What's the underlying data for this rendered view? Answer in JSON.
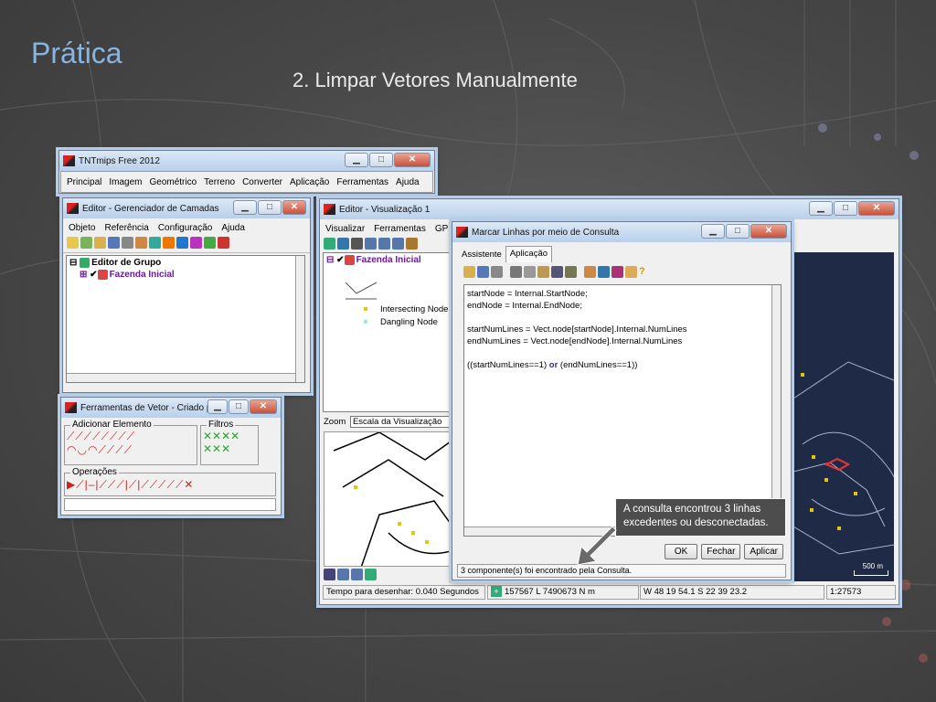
{
  "slide": {
    "title": "Prática",
    "subtitle": "2. Limpar Vetores Manualmente"
  },
  "tntmips": {
    "title": "TNTmips Free 2012",
    "menu": [
      "Principal",
      "Imagem",
      "Geométrico",
      "Terreno",
      "Converter",
      "Aplicação",
      "Ferramentas",
      "Ajuda"
    ]
  },
  "layer_manager": {
    "title": "Editor - Gerenciador de Camadas",
    "menu": [
      "Objeto",
      "Referência",
      "Configuração",
      "Ajuda"
    ],
    "group": "Editor de Grupo",
    "layer": "Fazenda Inicial"
  },
  "vector_tools": {
    "title": "Ferramentas de Vetor - Criado p...",
    "add_element": "Adicionar Elemento",
    "filters": "Filtros",
    "operations": "Operações"
  },
  "view_window": {
    "title": "Editor - Visualização 1",
    "menu": [
      "Visualizar",
      "Ferramentas",
      "GP"
    ],
    "layer": "Fazenda Inicial",
    "legend": [
      "Intersecting Node",
      "Dangling Node"
    ],
    "zoom_label": "Zoom",
    "zoom_value": "Escala da Visualização",
    "scale_bar": "500 m",
    "status": {
      "draw_time": "Tempo para desenhar: 0.040 Segundos",
      "coords": "157567 L  7490673 N m",
      "geo": "W 48 19 54.1  S 22 39 23.2",
      "scale": "1:27573"
    }
  },
  "query_dialog": {
    "title": "Marcar Linhas por meio de Consulta",
    "tabs": [
      "Assistente",
      "Aplicação"
    ],
    "code": [
      "startNode = Internal.StartNode;",
      "endNode = Internal.EndNode;",
      "",
      "startNumLines = Vect.node[startNode].Internal.NumLines",
      "endNumLines = Vect.node[endNode].Internal.NumLines",
      "",
      ""
    ],
    "code_last": {
      "a": "((startNumLines==1) ",
      "or": "or",
      "b": " (endNumLines==1))"
    },
    "buttons": {
      "ok": "OK",
      "close": "Fechar",
      "apply": "Aplicar"
    },
    "status": "3 componente(s) foi encontrado pela Consulta."
  },
  "callout": "A consulta encontrou 3 linhas excedentes  ou desconectadas."
}
